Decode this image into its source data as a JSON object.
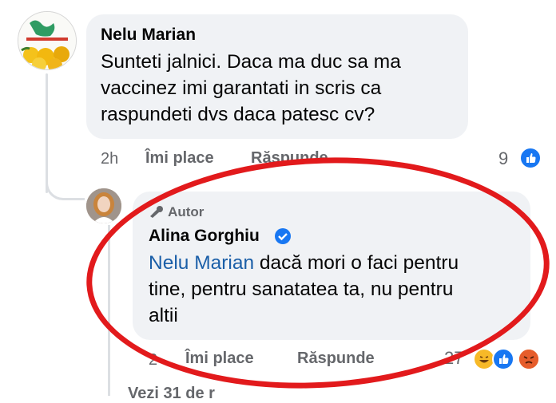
{
  "comment": {
    "author": "Nelu Marian",
    "lines": [
      "Sunteti jalnici. Daca ma duc sa ma",
      "vaccinez imi garantati in scris ca",
      "raspundeti dvs daca patesc cv?"
    ],
    "time": "2h",
    "like_label": "Îmi place",
    "reply_label": "Răspunde",
    "reaction_count": "9",
    "reactions": [
      "like-icon"
    ]
  },
  "reply": {
    "badge": "Autor",
    "author": "Alina Gorghiu",
    "mention": "Nelu Marian",
    "line1_rest": " dacă mori o faci pentru",
    "line2": "tine, pentru sanatatea ta, nu pentru",
    "line3": "altii",
    "time": "2",
    "like_label": "Îmi place",
    "reply_label": "Răspunde",
    "reaction_count": "27",
    "reactions": [
      "haha-icon",
      "like-icon",
      "angry-icon"
    ]
  },
  "next_item_partial": "Vezi 31 de r",
  "colors": {
    "bubble": "#f0f2f5",
    "mention": "#1b5fa8",
    "like": "#1877f2",
    "highlight": "#e21a1c"
  }
}
